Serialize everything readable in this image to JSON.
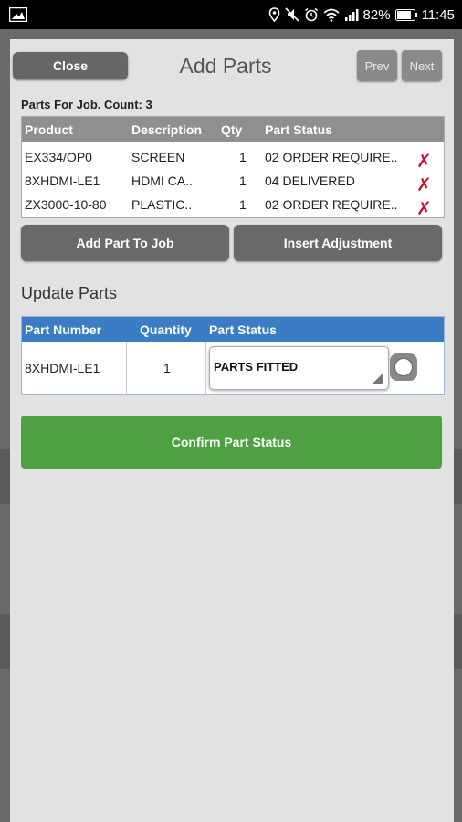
{
  "status_bar": {
    "battery": "82%",
    "time": "11:45"
  },
  "dialog": {
    "title": "Add Parts",
    "close_label": "Close",
    "prev_label": "Prev",
    "next_label": "Next"
  },
  "parts_for_job": {
    "label": "Parts For Job. Count: 3",
    "columns": [
      "Product",
      "Description",
      "Qty",
      "Part Status"
    ],
    "rows": [
      {
        "product": "EX334/OP0",
        "description": "SCREEN",
        "qty": "1",
        "status": "02 ORDER REQUIRE.."
      },
      {
        "product": "8XHDMI-LE1",
        "description": "HDMI CA..",
        "qty": "1",
        "status": "04 DELIVERED"
      },
      {
        "product": "ZX3000-10-80",
        "description": "PLASTIC..",
        "qty": "1",
        "status": "02 ORDER REQUIRE.."
      }
    ],
    "delete_glyph": "✗"
  },
  "actions": {
    "add_part_label": "Add Part To Job",
    "insert_adjustment_label": "Insert Adjustment"
  },
  "update_parts": {
    "heading": "Update Parts",
    "columns": [
      "Part Number",
      "Quantity",
      "Part Status"
    ],
    "part_number": "8XHDMI-LE1",
    "quantity": "1",
    "selected_status": "PARTS FITTED"
  },
  "confirm_label": "Confirm Part Status",
  "colors": {
    "confirm_green": "#4ea043",
    "header_blue": "#3b7dc4",
    "delete_red": "#c8102e"
  }
}
